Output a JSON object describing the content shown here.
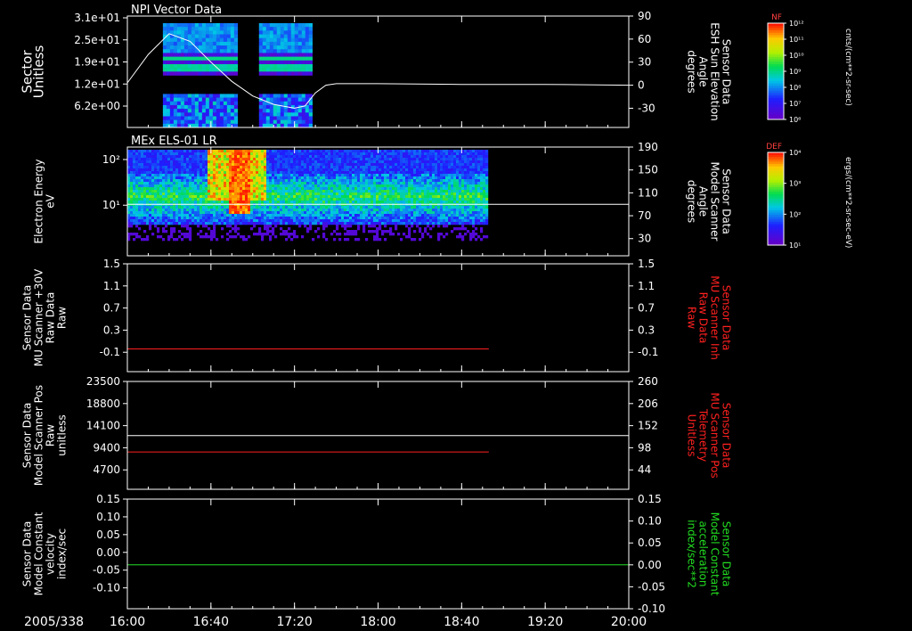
{
  "date_label": "2005/338",
  "time_ticks": [
    "16:00",
    "16:40",
    "17:20",
    "18:00",
    "18:40",
    "19:20",
    "20:00"
  ],
  "colors": {
    "white": "#ffffff",
    "red": "#ff2020",
    "green": "#22dd22",
    "background": "#000000"
  },
  "colorbars": [
    {
      "title": "NF",
      "unit": "cnts/(cm**2-sr-sec)",
      "tick_labels": [
        "10¹²",
        "10¹¹",
        "10¹⁰",
        "10⁹",
        "10⁸",
        "10⁷",
        "10⁶"
      ]
    },
    {
      "title": "DEF",
      "unit": "ergs/(cm**2-sr-sec-eV)",
      "tick_labels": [
        "10⁴",
        "10³",
        "10²",
        "10¹"
      ]
    }
  ],
  "chart_data": [
    {
      "type": "heatmap",
      "title": "NPI Vector Data",
      "ylabel": [
        "Sector",
        "Unitless"
      ],
      "yticks": [
        "3.1e+01",
        "2.5e+01",
        "1.9e+01",
        "1.2e+01",
        "6.2e+00"
      ],
      "y2label": [
        "Sensor Data",
        "ESH Sun Elevation",
        "Angle",
        "degrees"
      ],
      "y2ticks": [
        "90",
        "60",
        "30",
        "0",
        "-30"
      ],
      "y2lim": [
        -55,
        90
      ],
      "data_intervals": [
        [
          "16:17",
          "16:53"
        ],
        [
          "17:03",
          "17:29"
        ]
      ],
      "line_series": {
        "name": "ESH Sun Elevation Angle",
        "color": "#ffffff",
        "x": [
          "16:00",
          "16:10",
          "16:20",
          "16:30",
          "16:40",
          "16:50",
          "17:00",
          "17:10",
          "17:20",
          "17:25",
          "17:30",
          "17:35",
          "17:40",
          "18:00",
          "18:40",
          "19:20",
          "20:00"
        ],
        "y": [
          3,
          40,
          67,
          57,
          30,
          5,
          -14,
          -25,
          -30,
          -27,
          -10,
          0,
          2,
          2,
          1,
          1,
          0
        ]
      }
    },
    {
      "type": "heatmap",
      "title": "MEx ELS-01 LR",
      "ylabel": [
        "Electron Energy",
        "eV"
      ],
      "yticks": [
        "10²",
        "10¹"
      ],
      "y2label": [
        "Sensor Data",
        "Model Scanner",
        "Angle",
        "degrees"
      ],
      "y2ticks": [
        "190",
        "150",
        "110",
        "70",
        "30"
      ],
      "y2lim": [
        0,
        190
      ],
      "data_intervals": [
        [
          "16:00",
          "18:53"
        ]
      ],
      "line_series": {
        "name": "Model Scanner Angle",
        "color": "#ffffff",
        "x": [
          "16:00",
          "20:00"
        ],
        "y": [
          90,
          90
        ]
      }
    },
    {
      "type": "line",
      "ylabel": [
        "Sensor Data",
        "MU Scanner +30V",
        "Raw Data",
        "Raw"
      ],
      "yticks": [
        "1.5",
        "1.1",
        "0.7",
        "0.3",
        "-0.1"
      ],
      "ylim": [
        -0.4,
        1.5
      ],
      "y2label": [
        "Sensor Data",
        "MU Scanner Inh",
        "Raw Data",
        "Raw"
      ],
      "y2ticks": [
        "1.5",
        "1.1",
        "0.7",
        "0.3",
        "-0.1"
      ],
      "series": [
        {
          "color": "#ff2020",
          "x": [
            "16:00",
            "18:53"
          ],
          "y": [
            0,
            0
          ]
        }
      ]
    },
    {
      "type": "line",
      "ylabel": [
        "Sensor Data",
        "Model Scanner Pos",
        "Raw",
        "unitless"
      ],
      "yticks": [
        "23500",
        "18800",
        "14100",
        "9400",
        "4700"
      ],
      "ylim": [
        0,
        23500
      ],
      "y2label": [
        "Sensor Data",
        "MU Scanner Pos",
        "Telemetry",
        "Unitless"
      ],
      "y2ticks": [
        "260",
        "206",
        "152",
        "98",
        "44"
      ],
      "y2lim": [
        0,
        260
      ],
      "series": [
        {
          "color": "#ffffff",
          "x": [
            "16:00",
            "20:00"
          ],
          "y": [
            11700,
            11700
          ]
        },
        {
          "color": "#ff2020",
          "x": [
            "16:00",
            "18:53"
          ],
          "y": [
            90,
            90
          ]
        }
      ]
    },
    {
      "type": "line",
      "ylabel": [
        "Sensor Data",
        "Model Constant",
        "velocity",
        "index/sec"
      ],
      "yticks": [
        "0.15",
        "0.10",
        "0.05",
        "0.00",
        "-0.05",
        "-0.10"
      ],
      "ylim": [
        -0.1,
        0.15
      ],
      "y2label": [
        "Sensor Data",
        "Model Constant",
        "acceleration",
        "index/sec**2"
      ],
      "y2ticks": [
        "0.15",
        "0.10",
        "0.05",
        "0.00",
        "-0.05",
        "-0.10"
      ],
      "series": [
        {
          "color": "#22dd22",
          "x": [
            "16:00",
            "20:00"
          ],
          "y": [
            0,
            0
          ]
        }
      ]
    }
  ]
}
